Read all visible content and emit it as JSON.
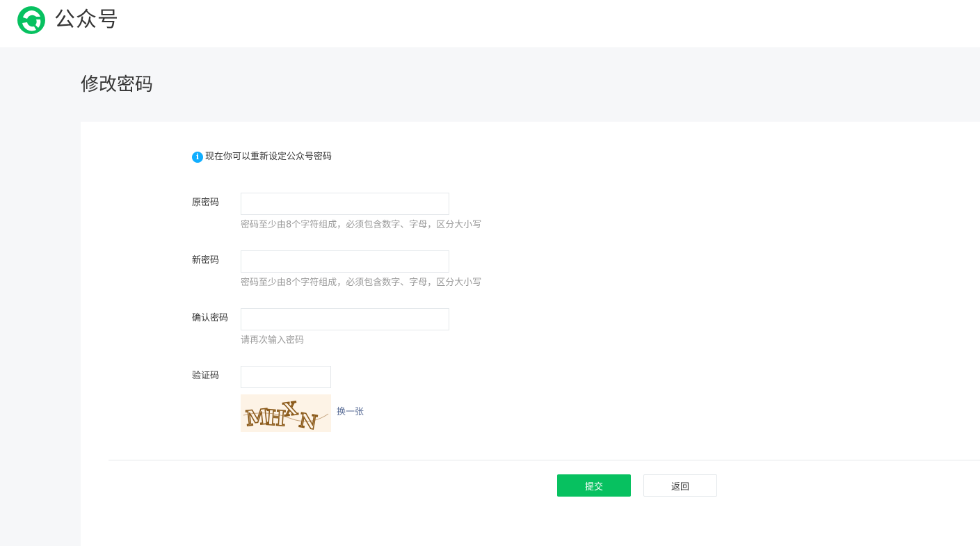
{
  "header": {
    "brand": "公众号",
    "logo_icon": "wechat-official-account-logo-icon",
    "brand_color": "#07c160"
  },
  "page": {
    "title": "修改密码"
  },
  "notice": {
    "icon": "info-icon",
    "text": "现在你可以重新设定公众号密码",
    "icon_color": "#10aeff"
  },
  "form": {
    "old_password": {
      "label": "原密码",
      "value": "",
      "hint": "密码至少由8个字符组成，必须包含数字、字母，区分大小写"
    },
    "new_password": {
      "label": "新密码",
      "value": "",
      "hint": "密码至少由8个字符组成，必须包含数字、字母，区分大小写"
    },
    "confirm_password": {
      "label": "确认密码",
      "value": "",
      "hint": "请再次输入密码"
    },
    "captcha": {
      "label": "验证码",
      "value": "",
      "image_text": "MHXN",
      "refresh_label": "换一张"
    }
  },
  "actions": {
    "submit_label": "提交",
    "back_label": "返回",
    "submit_color": "#07c160"
  }
}
